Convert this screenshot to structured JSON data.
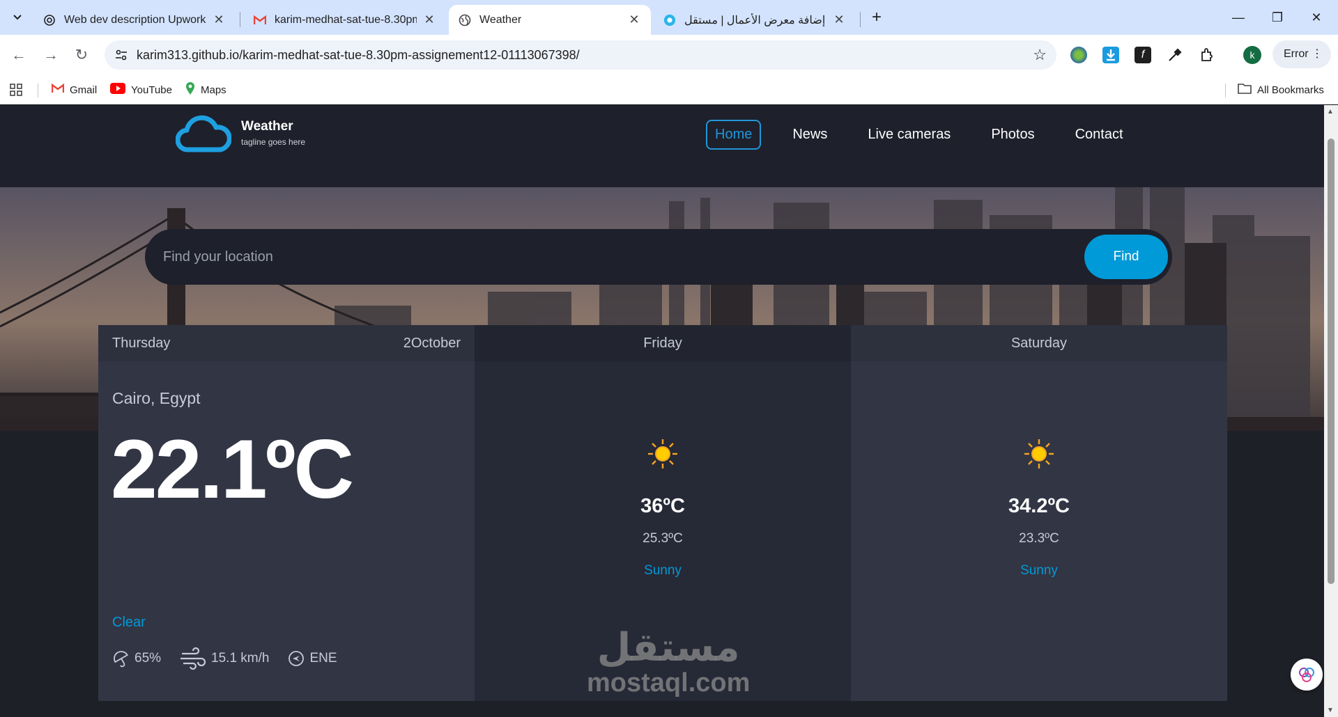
{
  "browser": {
    "tabs": [
      {
        "title": "Web dev description Upwork",
        "icon": "chatgpt-icon"
      },
      {
        "title": "karim-medhat-sat-tue-8.30pm-",
        "icon": "gmail-icon"
      },
      {
        "title": "Weather",
        "icon": "globe-icon"
      },
      {
        "title": "إضافة معرض الأعمال | مستقل",
        "icon": "mostaql-icon"
      }
    ],
    "url": "karim313.github.io/karim-medhat-sat-tue-8.30pm-assignement12-01113067398/",
    "profile_initial": "k",
    "error_label": "Error",
    "bookmarks": [
      {
        "label": "Gmail"
      },
      {
        "label": "YouTube"
      },
      {
        "label": "Maps"
      }
    ],
    "all_bookmarks": "All Bookmarks"
  },
  "site": {
    "logo_title": "Weather",
    "logo_tagline": "tagline goes here",
    "nav": [
      "Home",
      "News",
      "Live cameras",
      "Photos",
      "Contact"
    ],
    "active_nav": "Home"
  },
  "search": {
    "placeholder": "Find your location",
    "button": "Find"
  },
  "today": {
    "day": "Thursday",
    "date": "2October",
    "city": "Cairo, Egypt",
    "temp": "22.1ºC",
    "condition": "Clear",
    "icon": "moon-icon",
    "humidity": "65%",
    "wind": "15.1 km/h",
    "direction": "ENE"
  },
  "days": [
    {
      "day": "Friday",
      "max": "36ºC",
      "min": "25.3ºC",
      "condition": "Sunny",
      "icon": "sun-icon"
    },
    {
      "day": "Saturday",
      "max": "34.2ºC",
      "min": "23.3ºC",
      "condition": "Sunny",
      "icon": "sun-icon"
    }
  ],
  "watermark": {
    "arabic": "مستقل",
    "latin": "mostaql.com"
  },
  "colors": {
    "accent": "#009ad8",
    "header_bg": "#1e202b",
    "card_bg": "#323544"
  }
}
